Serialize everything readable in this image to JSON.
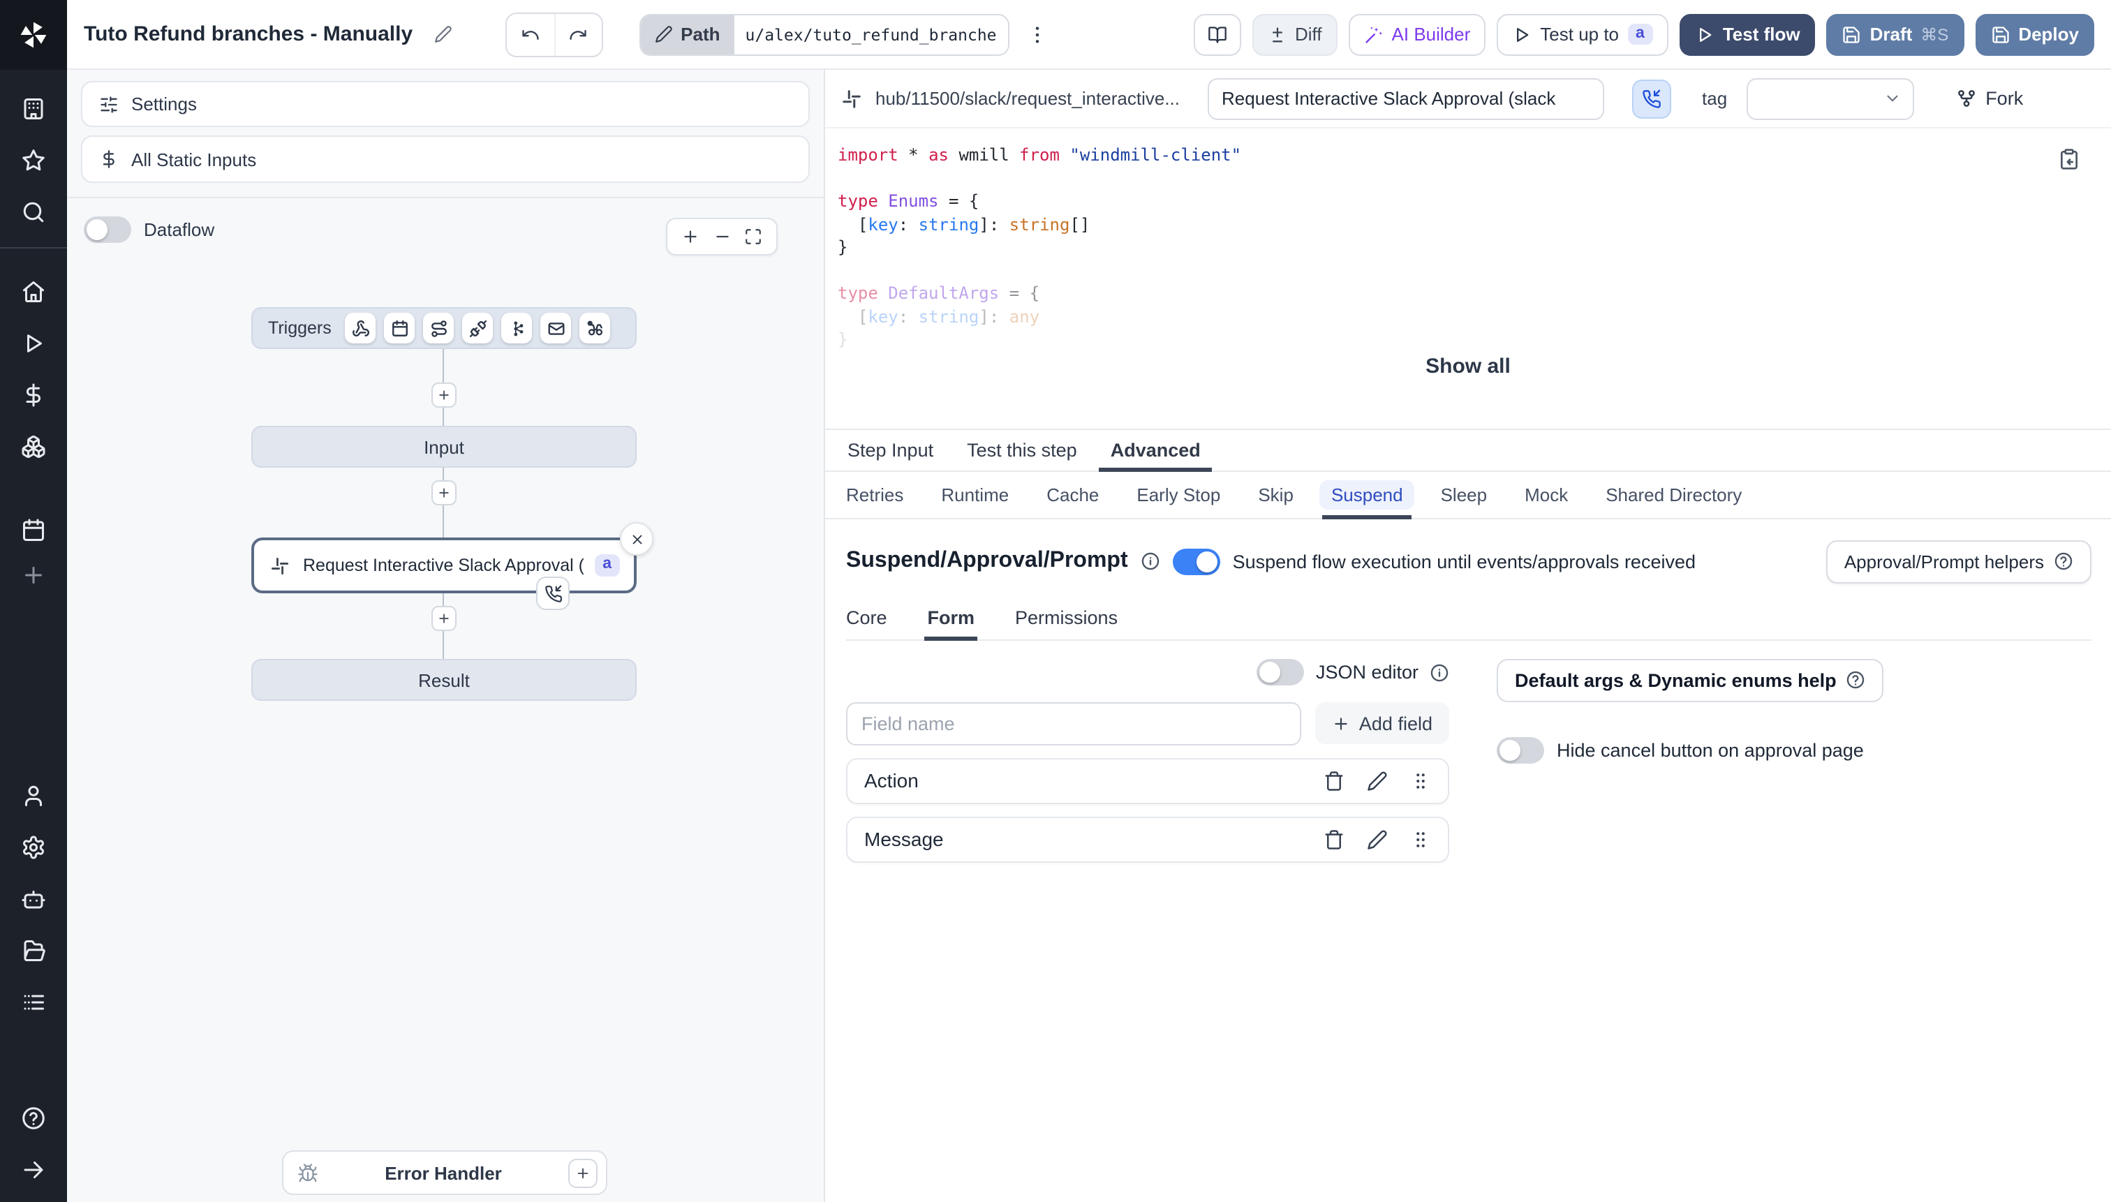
{
  "topbar": {
    "title": "Tuto Refund branches - Manually",
    "path_label": "Path",
    "path_value": "u/alex/tuto_refund_branches_",
    "diff": "Diff",
    "ai_builder": "AI Builder",
    "test_up_to": "Test up to",
    "test_up_to_badge": "a",
    "test_flow": "Test flow",
    "draft": "Draft",
    "draft_shortcut": "⌘S",
    "deploy": "Deploy"
  },
  "sidebar_icons": [
    "workspace",
    "favorites",
    "search",
    "home",
    "runs",
    "variables",
    "resources",
    "schedules",
    "add",
    "user",
    "settings",
    "workers",
    "folders",
    "logs",
    "help",
    "expand"
  ],
  "left_panel": {
    "settings": "Settings",
    "all_static_inputs": "All Static Inputs",
    "dataflow": "Dataflow",
    "flow": {
      "triggers": "Triggers",
      "trigger_icons": [
        "webhook",
        "schedule",
        "http-route",
        "websocket",
        "kafka",
        "email",
        "poll"
      ],
      "input": "Input",
      "step": "Request Interactive Slack Approval (...",
      "step_badge": "a",
      "result": "Result",
      "error_handler": "Error Handler"
    }
  },
  "editor": {
    "hub_path": "hub/11500/slack/request_interactive...",
    "name_value": "Request Interactive Slack Approval (slack",
    "tag_label": "tag",
    "fork": "Fork",
    "show_all": "Show all",
    "code": {
      "l1": {
        "k1": "import",
        "p1": " * ",
        "k2": "as",
        "p2": " wmill ",
        "k3": "from",
        "s1": " \"windmill-client\""
      },
      "l3": {
        "k1": "type",
        "t1": " Enums",
        "p1": " = {"
      },
      "l4": {
        "p1": "  [",
        "k1": "key",
        "p2": ": ",
        "t1": "string",
        "p3": "]: ",
        "t2": "string",
        "p4": "[]"
      },
      "l5": {
        "p1": "}"
      },
      "l7": {
        "k1": "type",
        "t1": " DefaultArgs",
        "p1": " = {"
      },
      "l8": {
        "p1": "  [",
        "k1": "key",
        "p2": ": ",
        "t1": "string",
        "p3": "]: ",
        "t2": "any"
      },
      "l9": {
        "p1": "}"
      }
    }
  },
  "tabs": {
    "items": [
      "Step Input",
      "Test this step",
      "Advanced"
    ],
    "active": "Advanced"
  },
  "advanced_tabs": {
    "items": [
      "Retries",
      "Runtime",
      "Cache",
      "Early Stop",
      "Skip",
      "Suspend",
      "Sleep",
      "Mock",
      "Shared Directory"
    ],
    "active": "Suspend"
  },
  "suspend": {
    "title": "Suspend/Approval/Prompt",
    "description": "Suspend flow execution until events/approvals received",
    "enabled": true,
    "helpers_button": "Approval/Prompt helpers",
    "tabs": [
      "Core",
      "Form",
      "Permissions"
    ],
    "active_tab": "Form",
    "json_editor": "JSON editor",
    "field_placeholder": "Field name",
    "add_field": "Add field",
    "fields": [
      "Action",
      "Message"
    ],
    "default_args_help": "Default args & Dynamic enums help",
    "hide_cancel": "Hide cancel button on approval page"
  },
  "colors": {
    "accent_blue": "#3b82f6",
    "test_flow_bg": "#3c4a6b",
    "draft_deploy_bg": "#5f7ca6",
    "suspend_active_text": "#2f4cc0",
    "badge_indigo": "#4a4fd8",
    "sidebar_bg": "#1d222a"
  }
}
